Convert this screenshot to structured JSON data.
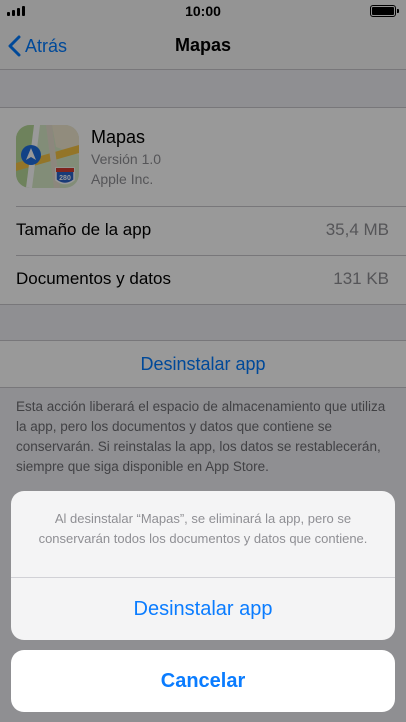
{
  "status_bar": {
    "time": "10:00"
  },
  "nav": {
    "back_label": "Atrás",
    "title": "Mapas"
  },
  "app": {
    "name": "Mapas",
    "version": "Versión 1.0",
    "developer": "Apple Inc.",
    "icon": "maps-app-icon",
    "icon_badge": "280"
  },
  "storage": {
    "rows": [
      {
        "label": "Tamaño de la app",
        "value": "35,4 MB"
      },
      {
        "label": "Documentos y datos",
        "value": "131 KB"
      }
    ]
  },
  "uninstall": {
    "label": "Desinstalar app",
    "note": "Esta acción liberará el espacio de almacenamiento que utiliza la app, pero los documentos y datos que contiene se conservarán. Si reinstalas la app, los datos se restablecerán, siempre que siga disponible en App Store."
  },
  "action_sheet": {
    "message": "Al desinstalar “Mapas”, se eliminará la app, pero se conservarán todos los documentos y datos que contiene.",
    "confirm_label": "Desinstalar app",
    "cancel_label": "Cancelar"
  },
  "colors": {
    "accent": "#007aff",
    "secondary_text": "#8e8e93",
    "background": "#efeff4"
  }
}
